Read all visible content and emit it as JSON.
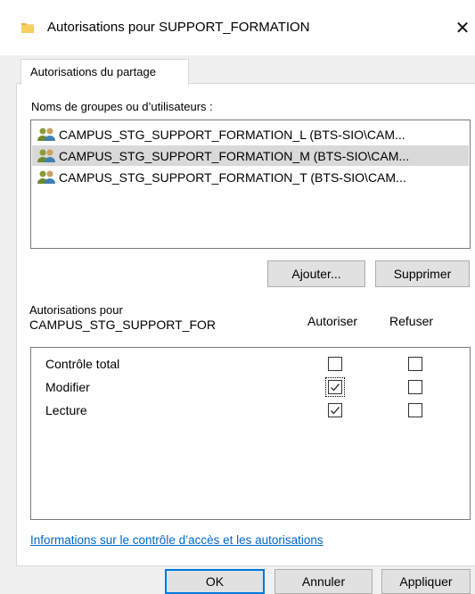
{
  "window": {
    "title": "Autorisations pour SUPPORT_FORMATION",
    "close_glyph": "✕"
  },
  "tabs": [
    {
      "label": "Autorisations du partage",
      "active": true
    }
  ],
  "groups": {
    "label": "Noms de groupes ou d’utilisateurs :",
    "items": [
      {
        "name": "CAMPUS_STG_SUPPORT_FORMATION_L (BTS-SIO\\CAM...",
        "icon": "user-group-icon",
        "selected": false
      },
      {
        "name": "CAMPUS_STG_SUPPORT_FORMATION_M (BTS-SIO\\CAM...",
        "icon": "user-group-icon",
        "selected": true
      },
      {
        "name": "CAMPUS_STG_SUPPORT_FORMATION_T (BTS-SIO\\CAM...",
        "icon": "user-group-icon",
        "selected": false
      }
    ],
    "add_label": "Ajouter...",
    "remove_label": "Supprimer"
  },
  "permissions": {
    "header_line1": "Autorisations pour",
    "header_line2": "CAMPUS_STG_SUPPORT_FOR",
    "allow_label": "Autoriser",
    "deny_label": "Refuser",
    "items": [
      {
        "label": "Contrôle total",
        "allow": false,
        "deny": false
      },
      {
        "label": "Modifier",
        "allow": true,
        "deny": false,
        "focused": true
      },
      {
        "label": "Lecture",
        "allow": true,
        "deny": false
      }
    ]
  },
  "info_link": "Informations sur le contrôle d’accès et les autorisations",
  "footer": {
    "ok_label": "OK",
    "cancel_label": "Annuler",
    "apply_label": "Appliquer"
  },
  "colors": {
    "selection": "#d9d9d9",
    "link": "#0066cc",
    "button_face": "#e1e1e1",
    "primary_border": "#0078d7"
  }
}
